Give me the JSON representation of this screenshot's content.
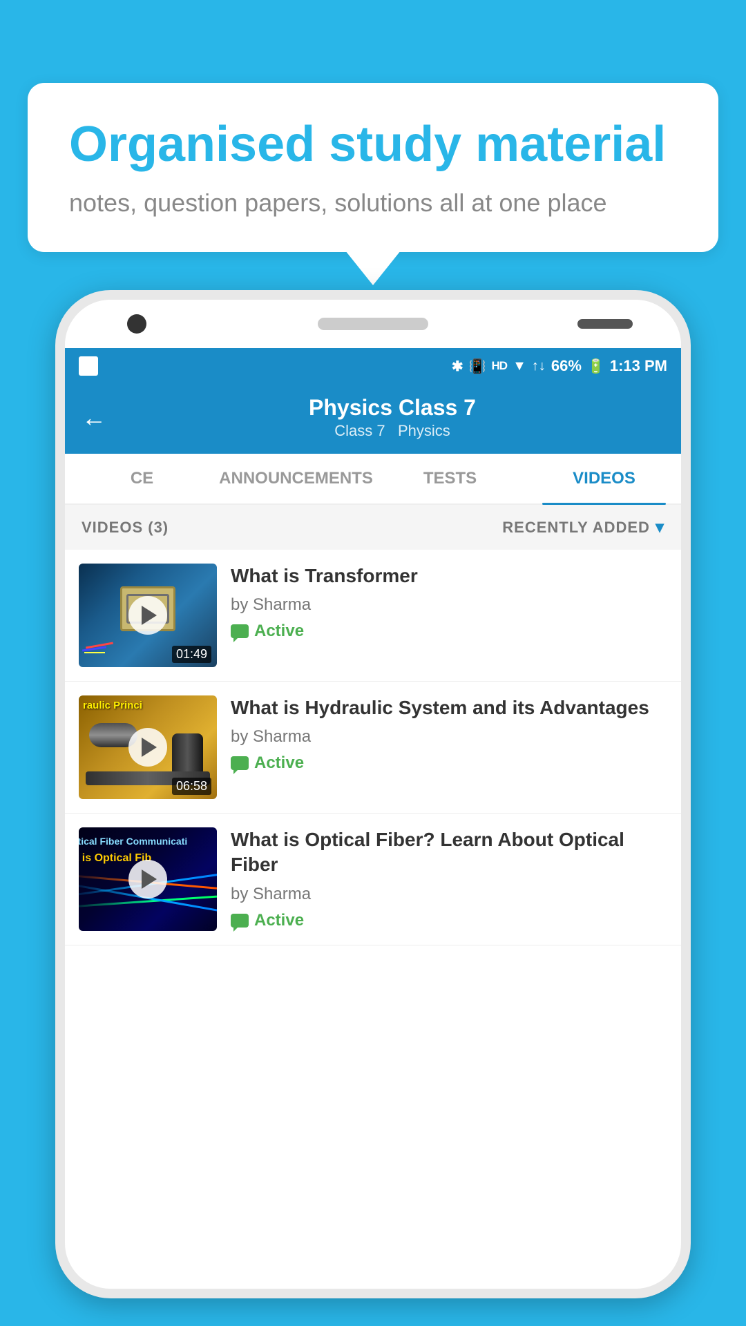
{
  "background_color": "#29b6e8",
  "speech_bubble": {
    "title": "Organised study material",
    "subtitle": "notes, question papers, solutions all at one place"
  },
  "status_bar": {
    "time": "1:13 PM",
    "battery": "66%",
    "signal_icons": [
      "bluetooth",
      "vibrate",
      "hd",
      "wifi",
      "signal",
      "x"
    ]
  },
  "app_header": {
    "title": "Physics Class 7",
    "subtitle_part1": "Class 7",
    "subtitle_separator": "  ",
    "subtitle_part2": "Physics",
    "back_label": "←"
  },
  "tabs": [
    {
      "id": "ce",
      "label": "CE",
      "active": false
    },
    {
      "id": "announcements",
      "label": "ANNOUNCEMENTS",
      "active": false
    },
    {
      "id": "tests",
      "label": "TESTS",
      "active": false
    },
    {
      "id": "videos",
      "label": "VIDEOS",
      "active": true
    }
  ],
  "videos_section": {
    "count_label": "VIDEOS (3)",
    "sort_label": "RECENTLY ADDED",
    "sort_icon": "chevron-down"
  },
  "videos": [
    {
      "id": 1,
      "title": "What is  Transformer",
      "author": "by Sharma",
      "status": "Active",
      "duration": "01:49",
      "thumb_text": "",
      "thumb_type": "transformer"
    },
    {
      "id": 2,
      "title": "What is Hydraulic System and its Advantages",
      "author": "by Sharma",
      "status": "Active",
      "duration": "06:58",
      "thumb_text": "raulic Princi",
      "thumb_type": "hydraulic"
    },
    {
      "id": 3,
      "title": "What is Optical Fiber? Learn About Optical Fiber",
      "author": "by Sharma",
      "status": "Active",
      "duration": "",
      "thumb_text_line1": "ptical Fiber Communicati",
      "thumb_text_line2": "t is Optical Fib",
      "thumb_type": "fiber"
    }
  ]
}
